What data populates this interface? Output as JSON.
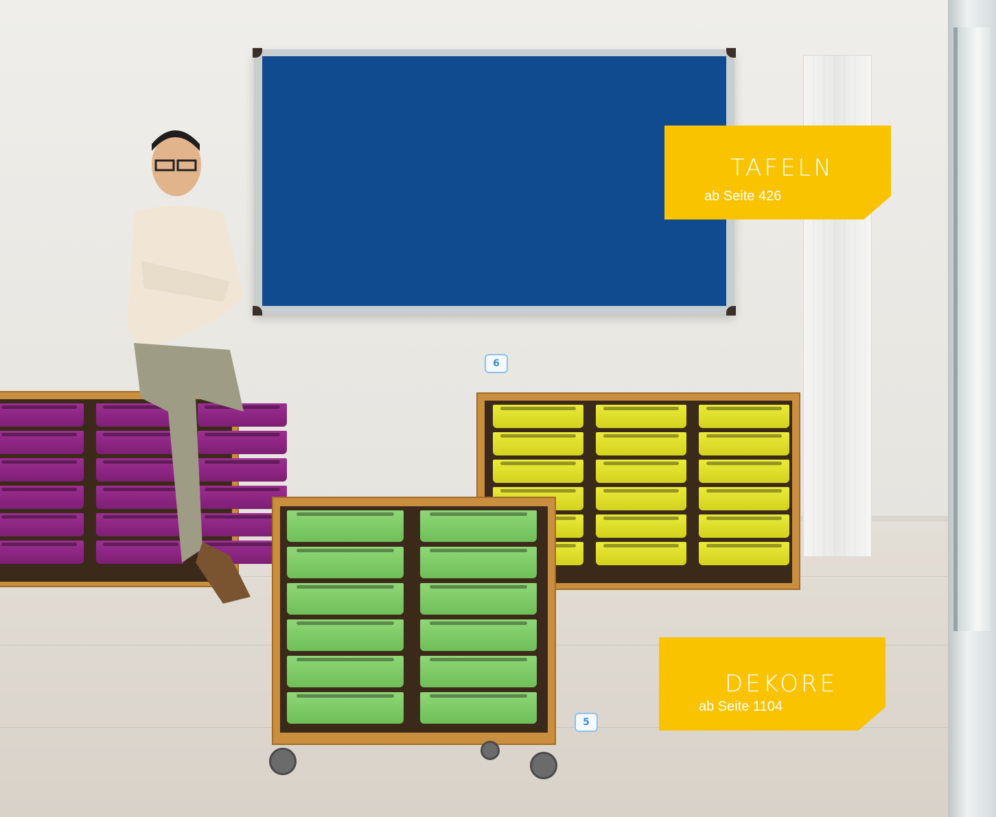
{
  "labels": {
    "tafeln": {
      "title": "TAFELN",
      "sub": "ab Seite 426"
    },
    "dekore": {
      "title": "DEKORE",
      "sub": "ab Seite 1104"
    }
  },
  "badges": {
    "top": "6",
    "bottom": "5"
  },
  "colors": {
    "label_bg": "#f9c300",
    "board": "#0f4b8e",
    "tray_purple": "#8a2380",
    "tray_yellow": "#dede2c",
    "tray_green": "#7dca66",
    "cabinet_wood": "#c98e3e",
    "badge_blue": "#3d8fd4"
  }
}
